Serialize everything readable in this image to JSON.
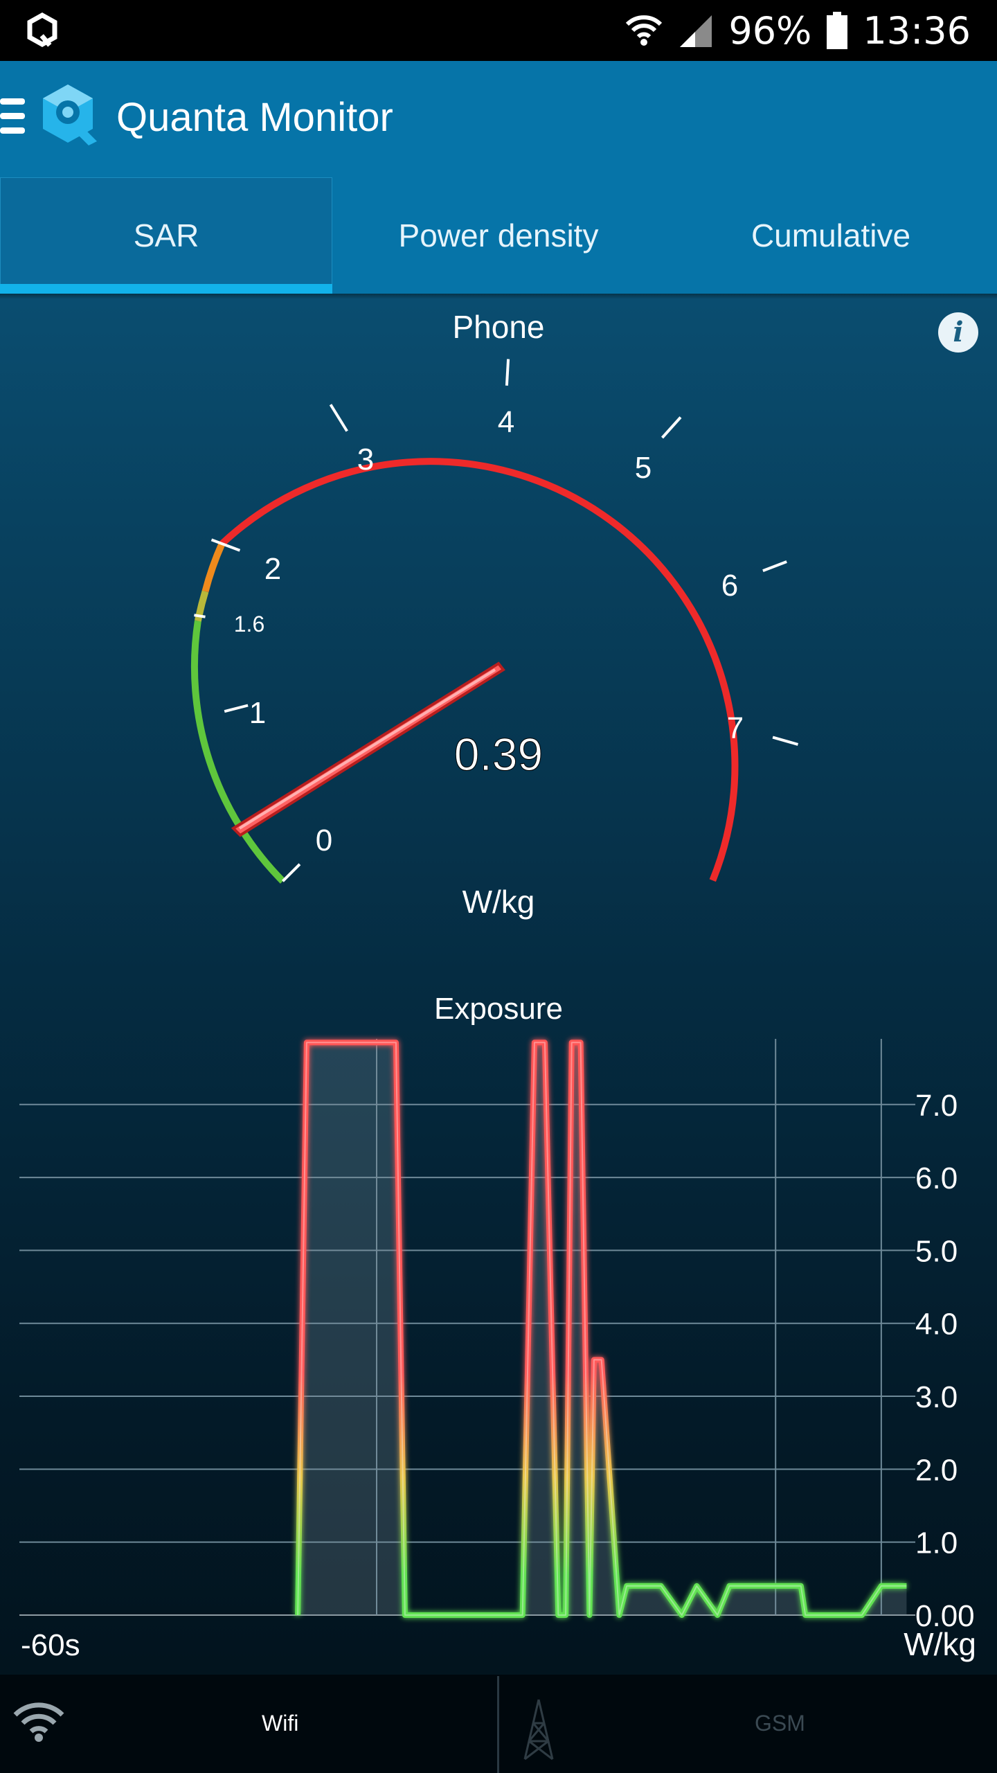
{
  "status_bar": {
    "battery": "96%",
    "time": "13:36"
  },
  "app_bar": {
    "title": "Quanta Monitor"
  },
  "tabs": [
    {
      "label": "SAR",
      "active": true
    },
    {
      "label": "Power density",
      "active": false
    },
    {
      "label": "Cumulative",
      "active": false
    }
  ],
  "gauge": {
    "title": "Phone",
    "value": "0.39",
    "unit": "W/kg",
    "ticks": [
      "0",
      "1",
      "1.6",
      "2",
      "3",
      "4",
      "5",
      "6",
      "7"
    ]
  },
  "chart_data": {
    "type": "line",
    "title": "Exposure",
    "x_start_label": "-60s",
    "x_range": [
      -60,
      0
    ],
    "ylim": [
      0,
      7.9
    ],
    "y_ticks": [
      "7.0",
      "6.0",
      "5.0",
      "4.0",
      "3.0",
      "2.0",
      "1.0",
      "0.00"
    ],
    "y_unit_label": "W/kg",
    "grid": true,
    "series": [
      {
        "x": [
          -41.3,
          -40.7,
          -34.7,
          -34.1,
          -32.6,
          -26.2,
          -25.4,
          -24.7,
          -23.8,
          -23.3,
          -22.9,
          -22.3,
          -21.7,
          -21.4,
          -20.9,
          -19.7,
          -19.2,
          -18.9,
          -16.9,
          -15.5,
          -14.5,
          -13.1,
          -12.3,
          -7.5,
          -7.2,
          -3.4,
          -2.1,
          -0.4
        ],
        "y": [
          0,
          7.85,
          7.85,
          0,
          0,
          0,
          7.85,
          7.85,
          0,
          0,
          7.85,
          7.85,
          0,
          3.5,
          3.5,
          0,
          0.4,
          0.4,
          0.4,
          0,
          0.4,
          0,
          0.4,
          0.4,
          0,
          0,
          0.4,
          0.4
        ]
      }
    ],
    "colors": {
      "low": "#62e252",
      "mid": "#e8c64c",
      "high": "#ff5656"
    }
  },
  "bottom_bar": {
    "wifi_label": "Wifi",
    "gsm_label": "GSM"
  },
  "colors": {
    "accent": "#0674a8",
    "tab_indicator": "#12b2ea",
    "gauge_red": "#ee2a2a",
    "gauge_green": "#5fc63c",
    "gauge_orange": "#ef8a1c"
  }
}
